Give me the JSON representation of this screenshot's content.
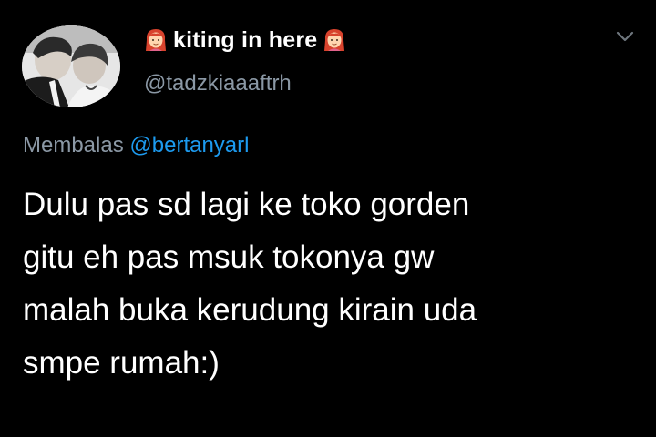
{
  "author": {
    "display_name": "kiting in here",
    "username": "@tadzkiaaaftrh",
    "name_emoji": "woman-red-hair-emoji"
  },
  "reply": {
    "prefix": "Membalas",
    "mention": "@bertanyarl"
  },
  "tweet": {
    "lines": [
      "Dulu pas sd lagi ke toko gorden",
      "gitu eh pas msuk tokonya gw",
      "malah buka kerudung kirain uda",
      "smpe rumah:)"
    ]
  },
  "icons": {
    "menu": "chevron-down-icon"
  },
  "colors": {
    "background": "#000000",
    "text": "#ffffff",
    "secondary": "#8b98a5",
    "link": "#1d9bf0"
  }
}
